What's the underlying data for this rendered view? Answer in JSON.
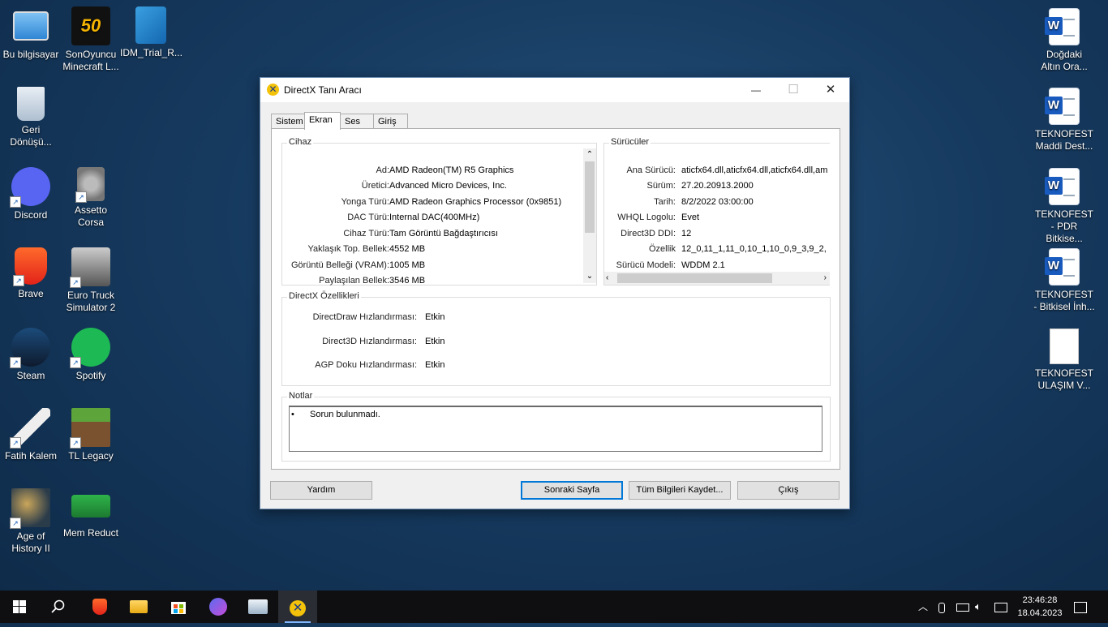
{
  "desktop": {
    "icons_left": [
      {
        "label": "Bu bilgisayar",
        "icon": "computer-icon"
      },
      {
        "label": "SonOyuncu Minecraft L...",
        "icon": "sonoyuncu-icon"
      },
      {
        "label": "IDM_Trial_R...",
        "icon": "registry-icon"
      },
      {
        "label": "Geri Dönüşü...",
        "icon": "recycle-bin-icon"
      },
      {
        "label": "Discord",
        "icon": "discord-icon"
      },
      {
        "label": "Assetto Corsa",
        "icon": "assetto-icon"
      },
      {
        "label": "Brave",
        "icon": "brave-icon"
      },
      {
        "label": "Euro Truck Simulator 2",
        "icon": "truck-icon"
      },
      {
        "label": "Steam",
        "icon": "steam-icon"
      },
      {
        "label": "Spotify",
        "icon": "spotify-icon"
      },
      {
        "label": "Fatih Kalem",
        "icon": "pen-icon"
      },
      {
        "label": "TL Legacy",
        "icon": "minecraft-icon"
      },
      {
        "label": "Age of History II",
        "icon": "map-icon"
      },
      {
        "label": "Mem Reduct",
        "icon": "memory-icon"
      }
    ],
    "icons_right": [
      {
        "label": "Doğdaki Altın Ora..."
      },
      {
        "label": "TEKNOFEST Maddi Dest..."
      },
      {
        "label": "TEKNOFEST - PDR Bitkise..."
      },
      {
        "label": "TEKNOFEST - Bitkisel İnh..."
      },
      {
        "label": "TEKNOFEST ULAŞIM V..."
      }
    ]
  },
  "window": {
    "title": "DirectX Tanı Aracı",
    "controls": {
      "minimize": "—",
      "maximize": "☐",
      "close": "✕"
    },
    "tabs": [
      "Sistem",
      "Ekran",
      "Ses",
      "Giriş"
    ],
    "active_tab": "Ekran",
    "device": {
      "title": "Cihaz",
      "rows": [
        {
          "label": "Ad:",
          "value": "AMD Radeon(TM) R5 Graphics"
        },
        {
          "label": "Üretici:",
          "value": "Advanced Micro Devices, Inc."
        },
        {
          "label": "Yonga Türü:",
          "value": "AMD Radeon Graphics Processor (0x9851)"
        },
        {
          "label": "DAC Türü:",
          "value": "Internal DAC(400MHz)"
        },
        {
          "label": "Cihaz Türü:",
          "value": "Tam Görüntü Bağdaştırıcısı"
        },
        {
          "label": "Yaklaşık Top. Bellek:",
          "value": "4552 MB"
        },
        {
          "label": "Görüntü Belleği (VRAM):",
          "value": "1005 MB"
        },
        {
          "label": "Paylaşılan Bellek:",
          "value": "3546 MB"
        }
      ]
    },
    "drivers": {
      "title": "Sürücüler",
      "rows": [
        {
          "label": "Ana Sürücü:",
          "value": "aticfx64.dll,aticfx64.dll,aticfx64.dll,am"
        },
        {
          "label": "Sürüm:",
          "value": "27.20.20913.2000"
        },
        {
          "label": "Tarih:",
          "value": "8/2/2022 03:00:00"
        },
        {
          "label": "WHQL Logolu:",
          "value": "Evet"
        },
        {
          "label": "Direct3D DDI:",
          "value": "12"
        },
        {
          "label": "Özellik",
          "value": "12_0,11_1,11_0,10_1,10_0,9_3,9_2,"
        },
        {
          "label": "Sürücü Modeli:",
          "value": "WDDM 2.1"
        }
      ]
    },
    "features": {
      "title": "DirectX Özellikleri",
      "rows": [
        {
          "label": "DirectDraw Hızlandırması:",
          "value": "Etkin"
        },
        {
          "label": "Direct3D Hızlandırması:",
          "value": "Etkin"
        },
        {
          "label": "AGP Doku Hızlandırması:",
          "value": "Etkin"
        }
      ]
    },
    "notes": {
      "title": "Notlar",
      "items": [
        "Sorun bulunmadı."
      ]
    },
    "buttons": {
      "help": "Yardım",
      "next": "Sonraki Sayfa",
      "save": "Tüm Bilgileri Kaydet...",
      "exit": "Çıkış"
    }
  },
  "taskbar": {
    "time": "23:46:28",
    "date": "18.04.2023",
    "apps": [
      "start-icon",
      "search-icon",
      "brave-icon",
      "file-explorer-icon",
      "store-icon",
      "game-app-icon",
      "display-app-icon",
      "directx-icon"
    ]
  }
}
